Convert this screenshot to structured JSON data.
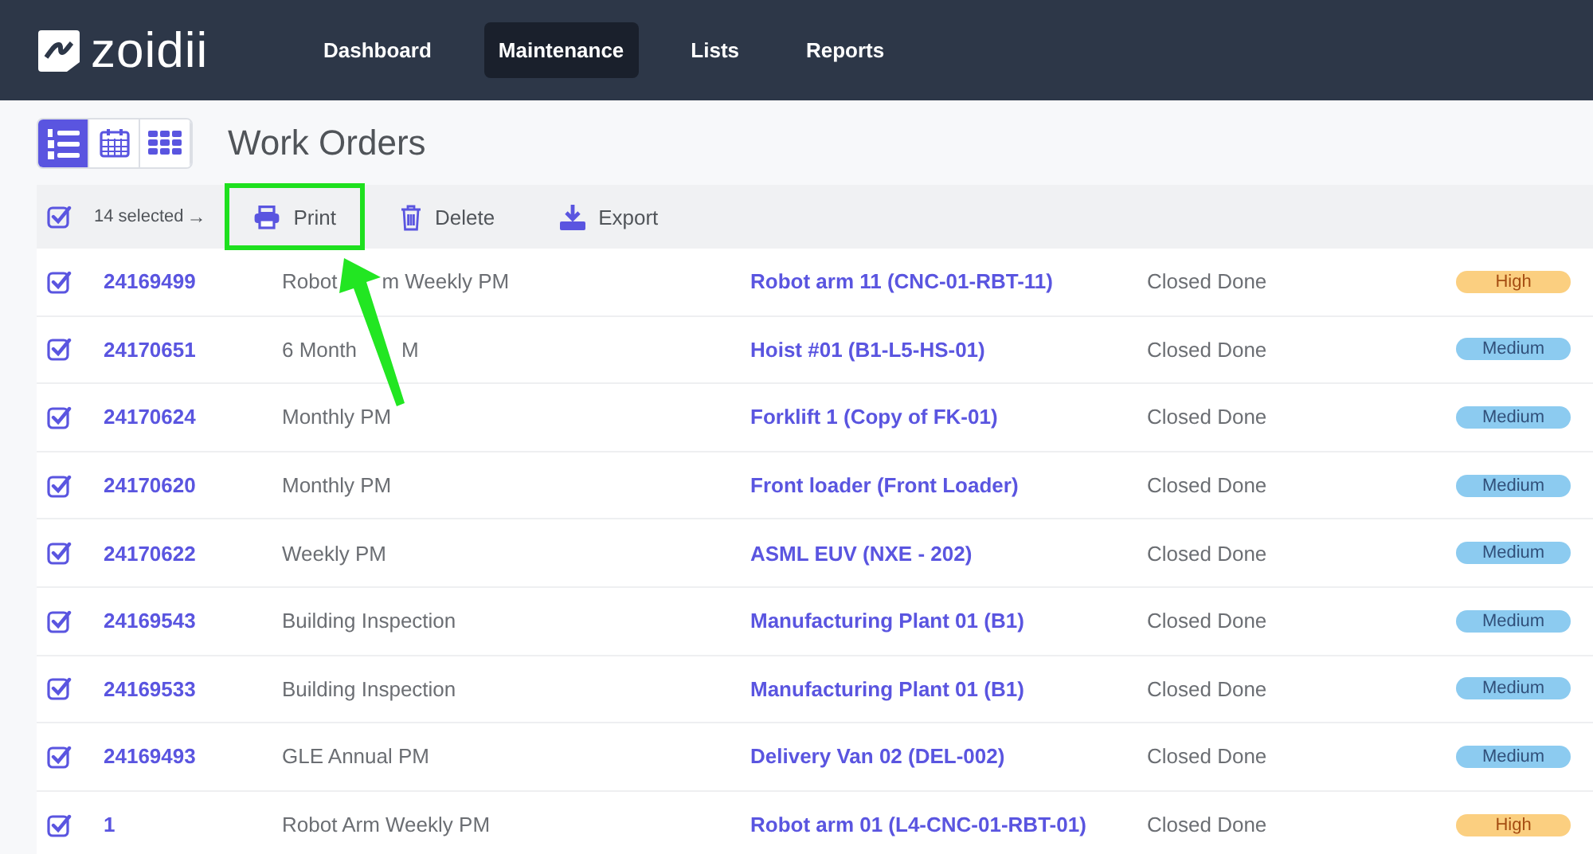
{
  "brand": "zoidii",
  "nav": [
    {
      "label": "Dashboard",
      "selected": false
    },
    {
      "label": "Maintenance",
      "selected": true
    },
    {
      "label": "Lists",
      "selected": false
    },
    {
      "label": "Reports",
      "selected": false
    }
  ],
  "views": [
    {
      "kind": "list",
      "selected": true
    },
    {
      "kind": "calendar",
      "selected": false
    },
    {
      "kind": "grid",
      "selected": false
    }
  ],
  "title": "Work Orders",
  "toolbar": {
    "all_checked": true,
    "selected_count": "14 selected",
    "arrow": "→",
    "actions": [
      {
        "kind": "print",
        "label": "Print",
        "highlighted": true
      },
      {
        "kind": "delete",
        "label": "Delete",
        "highlighted": false
      },
      {
        "kind": "export",
        "label": "Export",
        "highlighted": false
      }
    ]
  },
  "rows": [
    {
      "checked": true,
      "id": "24169499",
      "description": [
        "Robot",
        "m Weekly PM"
      ],
      "asset": "Robot arm 11 (CNC-01-RBT-11)",
      "status": "Closed Done",
      "priority": "High",
      "color": "#fbcf80"
    },
    {
      "checked": true,
      "id": "24170651",
      "description": [
        "6 Month",
        "M"
      ],
      "asset": "Hoist #01 (B1-L5-HS-01)",
      "status": "Closed Done",
      "priority": "Medium",
      "color": "#8ccbf0"
    },
    {
      "checked": true,
      "id": "24170624",
      "description": [
        "Monthly PM"
      ],
      "asset": "Forklift 1 (Copy of FK-01)",
      "status": "Closed Done",
      "priority": "Medium",
      "color": "#8ccbf0"
    },
    {
      "checked": true,
      "id": "24170620",
      "description": [
        "Monthly PM"
      ],
      "asset": "Front loader (Front Loader)",
      "status": "Closed Done",
      "priority": "Medium",
      "color": "#8ccbf0"
    },
    {
      "checked": true,
      "id": "24170622",
      "description": [
        "Weekly PM"
      ],
      "asset": "ASML EUV (NXE - 202)",
      "status": "Closed Done",
      "priority": "Medium",
      "color": "#8ccbf0"
    },
    {
      "checked": true,
      "id": "24169543",
      "description": [
        "Building Inspection"
      ],
      "asset": "Manufacturing Plant 01 (B1)",
      "status": "Closed Done",
      "priority": "Medium",
      "color": "#8ccbf0"
    },
    {
      "checked": true,
      "id": "24169533",
      "description": [
        "Building Inspection"
      ],
      "asset": "Manufacturing Plant 01 (B1)",
      "status": "Closed Done",
      "priority": "Medium",
      "color": "#8ccbf0"
    },
    {
      "checked": true,
      "id": "24169493",
      "description": [
        "GLE Annual PM"
      ],
      "asset": "Delivery Van 02 (DEL-002)",
      "status": "Closed Done",
      "priority": "Medium",
      "color": "#8ccbf0"
    },
    {
      "checked": true,
      "id": "1",
      "description": [
        "Robot Arm Weekly PM"
      ],
      "asset": "Robot arm 01 (L4-CNC-01-RBT-01)",
      "status": "Closed Done",
      "priority": "High",
      "color": "#fbcf80"
    }
  ]
}
